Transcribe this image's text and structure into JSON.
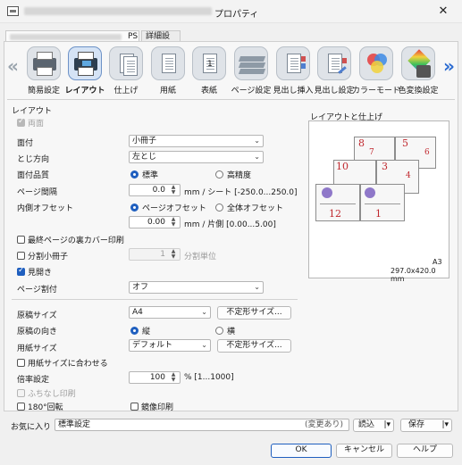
{
  "window": {
    "title_suffix": "プロパティ",
    "close_glyph": "✕"
  },
  "tabs": [
    {
      "label": "PS"
    },
    {
      "label": "詳細設定"
    }
  ],
  "nav": {
    "items": [
      {
        "label": "簡易設定",
        "icon": "printer-icon"
      },
      {
        "label": "レイアウト",
        "icon": "layout-printer-icon",
        "selected": true
      },
      {
        "label": "仕上げ",
        "icon": "finishing-doc-icon"
      },
      {
        "label": "用紙",
        "icon": "paper-doc-icon"
      },
      {
        "label": "表紙",
        "icon": "cover-icon"
      },
      {
        "label": "ページ設定",
        "icon": "page-stack-icon"
      },
      {
        "label": "見出し挿入",
        "icon": "insert-tab-icon"
      },
      {
        "label": "見出し設定",
        "icon": "tab-setting-icon"
      },
      {
        "label": "カラーモード",
        "icon": "color-circles-icon"
      },
      {
        "label": "色変換設定",
        "icon": "color-convert-icon"
      }
    ]
  },
  "layout": {
    "heading": "レイアウト",
    "duplex_label": "両面",
    "imposition_label": "面付",
    "imposition_value": "小冊子",
    "binding_label": "とじ方向",
    "binding_value": "左とじ",
    "quality_label": "面付品質",
    "quality_standard": "標準",
    "quality_high": "高精度",
    "gap_label": "ページ間隔",
    "gap_value": "0.0",
    "gap_unit": "mm / シート [-250.0...250.0]",
    "offset_label": "内側オフセット",
    "offset_page": "ページオフセット",
    "offset_whole": "全体オフセット",
    "offset_value": "0.00",
    "offset_unit": "mm / 片側 [0.00...5.00]",
    "back_cover_label": "最終ページの裏カバー印刷",
    "split_label": "分割小冊子",
    "split_value": "1",
    "split_unit": "分割単位",
    "spread_label": "見開き",
    "page_split_label": "ページ割付",
    "page_split_value": "オフ"
  },
  "paper": {
    "orig_size_label": "原稿サイズ",
    "orig_size_value": "A4",
    "custom_size_btn": "不定形サイズ...",
    "orientation_label": "原稿の向き",
    "portrait": "縦",
    "landscape": "横",
    "paper_size_label": "用紙サイズ",
    "paper_size_value": "デフォルト",
    "fit_label": "用紙サイズに合わせる",
    "zoom_label": "倍率設定",
    "zoom_value": "100",
    "zoom_unit": "% [1...1000]",
    "borderless_label": "ふちなし印刷",
    "rotate_label": "180°回転",
    "mirror_label": "鏡像印刷"
  },
  "preview": {
    "heading": "レイアウトと仕上げ",
    "pages_back": [
      "8",
      "5"
    ],
    "pages_mid": [
      "10",
      "3"
    ],
    "pages_front": [
      "12",
      "1"
    ],
    "back_tabs": [
      "6",
      "7"
    ],
    "mid_tabs": [
      "4"
    ],
    "paper_name": "A3",
    "paper_dims": "297.0x420.0 mm"
  },
  "bottom": {
    "fav_label": "お気に入り",
    "fav_value": "標準設定",
    "fav_changed": "(変更あり)",
    "load_btn": "読込",
    "save_btn": "保存",
    "ok_btn": "OK",
    "cancel_btn": "キャンセル",
    "help_btn": "ヘルプ"
  },
  "colors": {
    "accent": "#1f5fbf",
    "page_number": "#c0282e"
  }
}
